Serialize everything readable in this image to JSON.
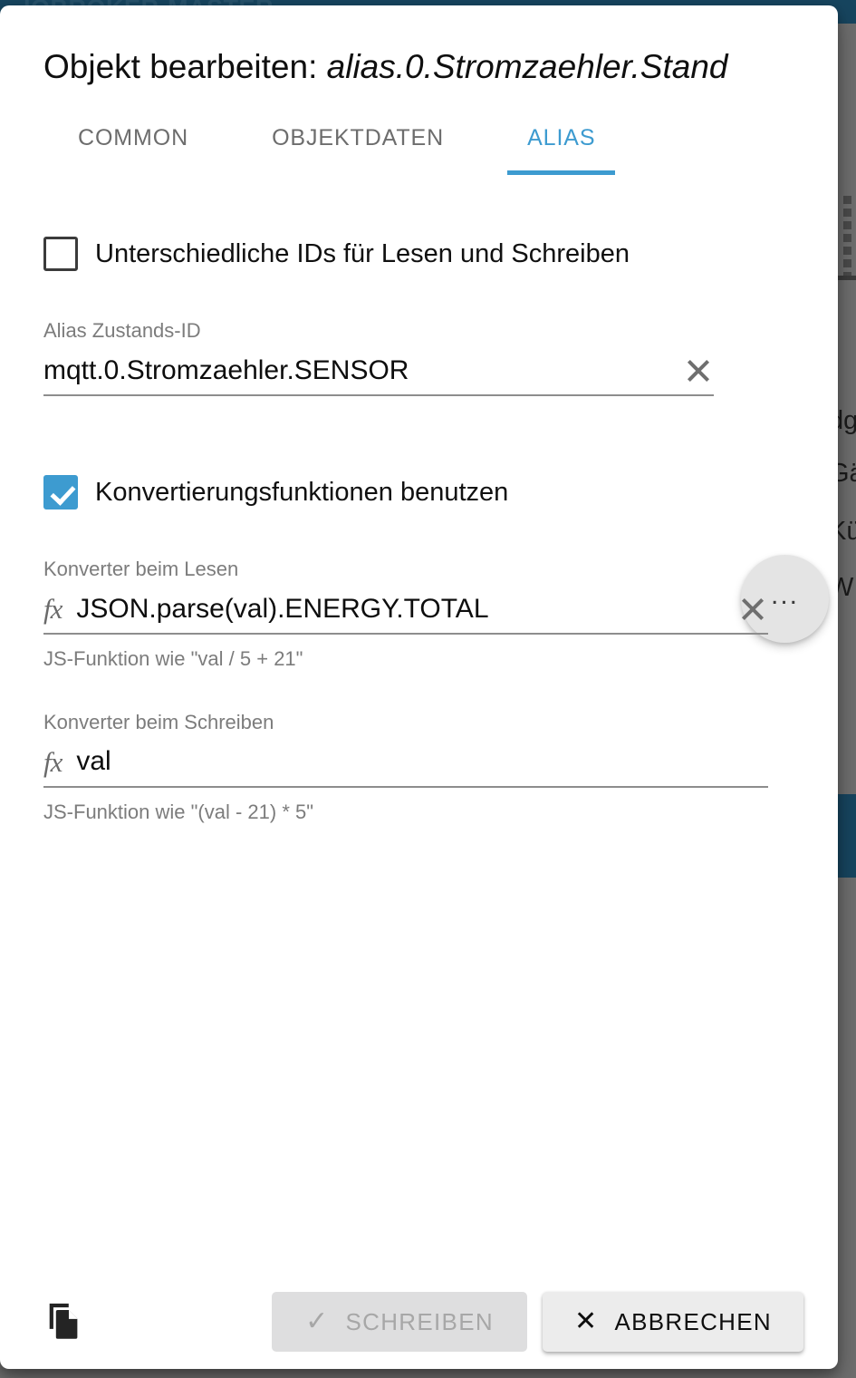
{
  "background": {
    "app_title_partial": "IOBROKER-MASTER",
    "list_items_partial": [
      "dg",
      "Gä",
      "Kü",
      "W"
    ],
    "colors": {
      "topbar": "#17455f",
      "overlay": "#6e6e6e",
      "band": "#17455f"
    }
  },
  "dialog": {
    "title_prefix": "Objekt bearbeiten: ",
    "title_object_id": "alias.0.Stromzaehler.Stand",
    "tabs": [
      {
        "label": "COMMON",
        "active": false
      },
      {
        "label": "OBJEKTDATEN",
        "active": false
      },
      {
        "label": "ALIAS",
        "active": true
      }
    ],
    "accent_color": "#3d9bd0",
    "checkbox_different_ids": {
      "label": "Unterschiedliche IDs für Lesen und Schreiben",
      "checked": false
    },
    "alias_state_id": {
      "label": "Alias Zustands-ID",
      "value": "mqtt.0.Stromzaehler.SENSOR",
      "clear_icon": "close-icon"
    },
    "select_button": {
      "label": "...",
      "icon": "ellipsis-icon"
    },
    "checkbox_use_conversion": {
      "label": "Konvertierungsfunktionen benutzen",
      "checked": true
    },
    "converter_read": {
      "label": "Konverter beim Lesen",
      "icon": "function-icon",
      "value": "JSON.parse(val).ENERGY.TOTAL",
      "help": "JS-Funktion wie \"val / 5 + 21\"",
      "clear_icon": "close-icon"
    },
    "converter_write": {
      "label": "Konverter beim Schreiben",
      "icon": "function-icon",
      "value": "val",
      "help": "JS-Funktion wie \"(val - 21) * 5\""
    },
    "footer": {
      "copy_icon": "copy-icon",
      "write_button": {
        "label": "SCHREIBEN",
        "icon": "check-icon",
        "disabled": true
      },
      "cancel_button": {
        "label": "ABBRECHEN",
        "icon": "close-icon",
        "disabled": false
      }
    }
  }
}
